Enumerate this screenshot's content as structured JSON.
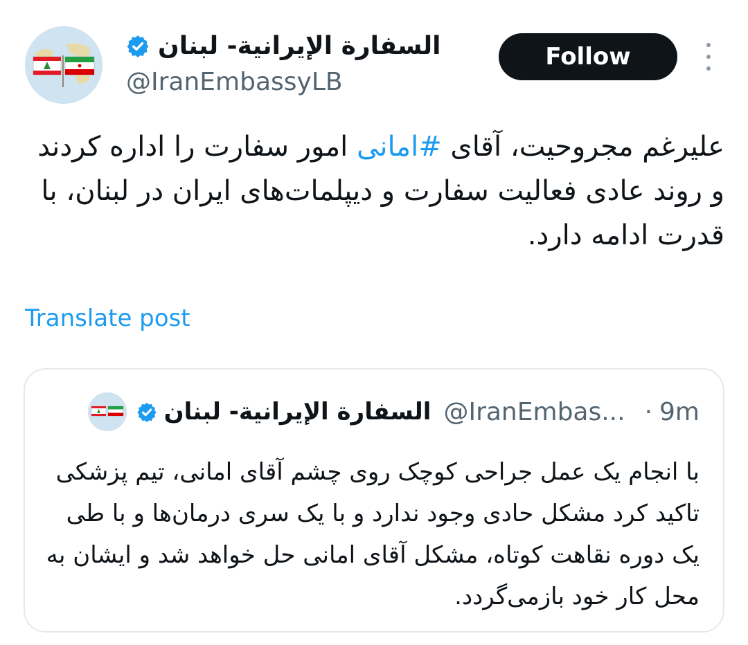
{
  "author": {
    "display_name": "السفارة الإيرانية- لبنان",
    "handle": "@IranEmbassyLB",
    "avatar_icon": "embassy-flags-avatar",
    "verified_icon": "verified-badge-icon"
  },
  "actions": {
    "follow_label": "Follow",
    "more_icon": "more-vertical-icon"
  },
  "post": {
    "text_before": "علیرغم مجروحیت، آقای ",
    "hashtag": "#امانی",
    "text_after": " امور سفارت را اداره کردند و روند عادی فعالیت سفارت و دیپلمات‌های ایران در لبنان، با قدرت ادامه دارد.",
    "translate_label": "Translate post"
  },
  "quoted_post": {
    "display_name": "السفارة الإيرانية- لبنان",
    "handle": "@IranEmbas...",
    "separator": "·",
    "time": "9m",
    "text": "با انجام یک عمل جراحی کوچک روی چشم آقای امانی، تیم پزشکی تاکید کرد مشکل حادی وجود ندارد و با یک سری درمان‌ها و با طی یک دوره نقاهت کوتاه، مشکل آقای امانی حل خواهد شد و ایشان به محل کار خود بازمی‌گردد."
  },
  "colors": {
    "accent": "#1d9bf0",
    "text": "#0f1419",
    "secondary": "#536471",
    "border": "#e4e8ec",
    "button_bg": "#0f1419"
  }
}
